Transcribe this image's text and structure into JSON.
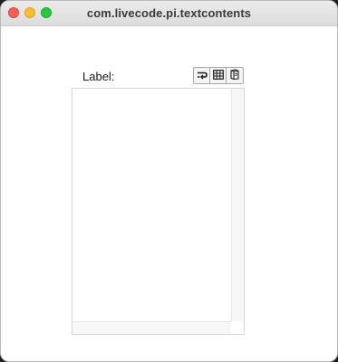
{
  "window": {
    "title": "com.livecode.pi.textcontents"
  },
  "field": {
    "label": "Label:",
    "text": ""
  },
  "toolbar": {
    "buttons": [
      {
        "icon": "text-wrap-icon"
      },
      {
        "icon": "table-grid-icon"
      },
      {
        "icon": "text-document-icon"
      }
    ]
  },
  "colors": {
    "close": "#fe5f57",
    "minimize": "#febc2e",
    "zoom": "#28c840"
  }
}
